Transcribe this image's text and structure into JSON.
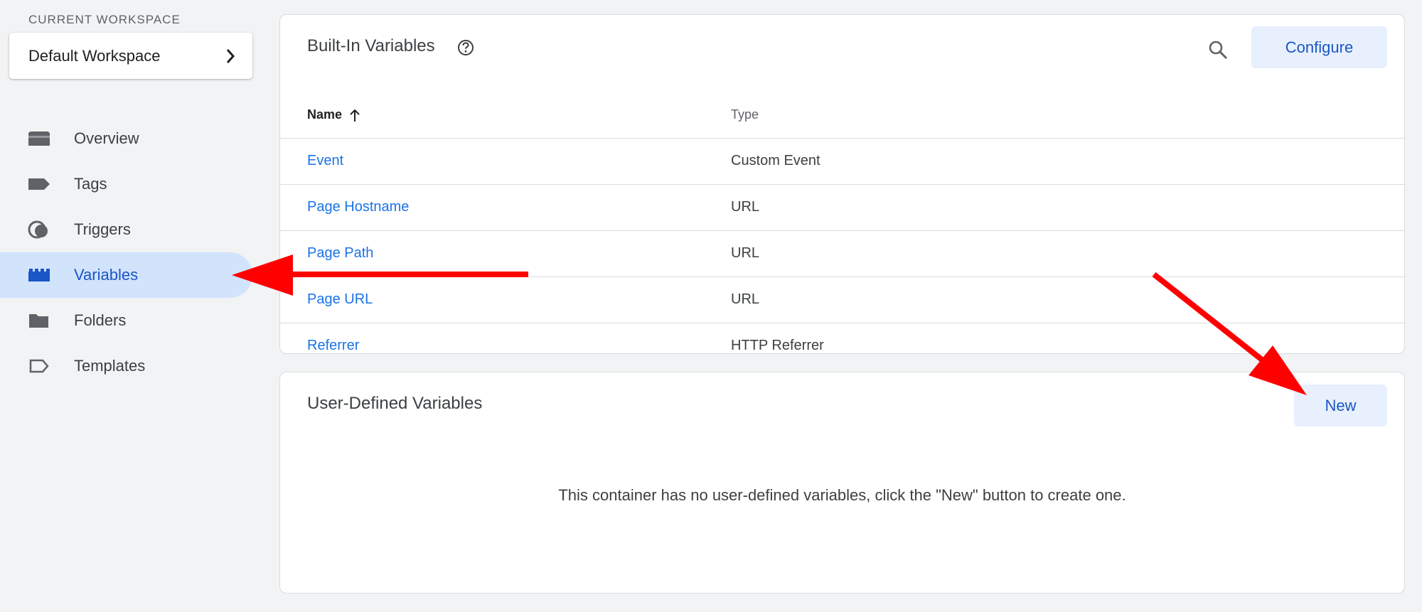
{
  "workspace": {
    "caption": "CURRENT WORKSPACE",
    "name": "Default Workspace"
  },
  "nav": {
    "items": [
      {
        "label": "Overview",
        "icon": "overview-icon",
        "active": false
      },
      {
        "label": "Tags",
        "icon": "tag-icon",
        "active": false
      },
      {
        "label": "Triggers",
        "icon": "trigger-icon",
        "active": false
      },
      {
        "label": "Variables",
        "icon": "variables-icon",
        "active": true
      },
      {
        "label": "Folders",
        "icon": "folder-icon",
        "active": false
      },
      {
        "label": "Templates",
        "icon": "template-icon",
        "active": false
      }
    ]
  },
  "builtin": {
    "title": "Built-In Variables",
    "configure_label": "Configure",
    "columns": {
      "name": "Name",
      "type": "Type"
    },
    "rows": [
      {
        "name": "Event",
        "type": "Custom Event"
      },
      {
        "name": "Page Hostname",
        "type": "URL"
      },
      {
        "name": "Page Path",
        "type": "URL"
      },
      {
        "name": "Page URL",
        "type": "URL"
      },
      {
        "name": "Referrer",
        "type": "HTTP Referrer"
      }
    ]
  },
  "user_defined": {
    "title": "User-Defined Variables",
    "new_label": "New",
    "empty_message": "This container has no user-defined variables, click the \"New\" button to create one."
  },
  "colors": {
    "accent": "#1a73e8",
    "active_nav_bg": "#d2e3fc",
    "button_bg": "#e8f0fe",
    "annotation_arrow": "#ff0000"
  }
}
